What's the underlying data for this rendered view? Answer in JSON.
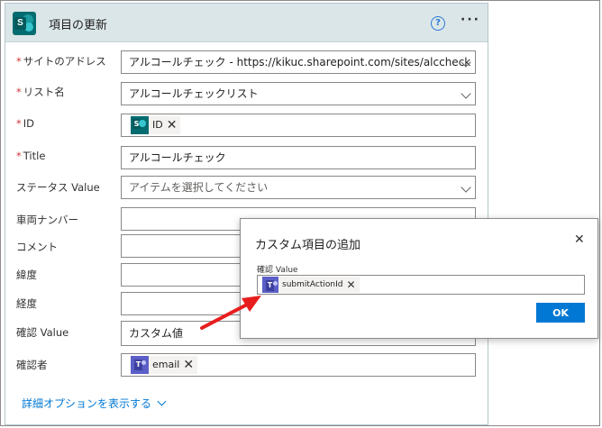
{
  "card": {
    "title": "項目の更新",
    "help_glyph": "?",
    "more_glyph": "···"
  },
  "fields": [
    {
      "label": "サイトのアドレス",
      "required": true,
      "value": "アルコールチェック - https://kikuc.sharepoint.com/sites/alccheck",
      "dropdown": true
    },
    {
      "label": "リスト名",
      "required": true,
      "value": "アルコールチェックリスト",
      "dropdown": true
    },
    {
      "label": "ID",
      "required": true,
      "token": "ID",
      "token_icon": "sharepoint-icon"
    },
    {
      "label": "Title",
      "required": true,
      "value": "アルコールチェック"
    },
    {
      "label": "ステータス Value",
      "required": false,
      "placeholder": "アイテムを選択してください",
      "dropdown": true
    },
    {
      "label": "車両ナンバー",
      "required": false,
      "value": ""
    },
    {
      "label": "コメント",
      "required": false,
      "value": ""
    },
    {
      "label": "緯度",
      "required": false,
      "value": ""
    },
    {
      "label": "経度",
      "required": false,
      "value": ""
    },
    {
      "label": "確認 Value",
      "required": false,
      "value": "カスタム値"
    },
    {
      "label": "確認者",
      "required": false,
      "token": "email",
      "token_icon": "teams-icon"
    }
  ],
  "required_mark": "*",
  "advanced_options": "詳細オプションを表示する",
  "dialog": {
    "title": "カスタム項目の追加",
    "close_glyph": "✕",
    "field_label": "確認 Value",
    "token": "submitActionId",
    "ok_label": "OK"
  },
  "colors": {
    "header_bg": "#dbe6e9",
    "accent": "#0078d4",
    "required": "#d13438",
    "arrow": "#e81e1e",
    "sharepoint": "#036c70",
    "teams": "#5b5fc7"
  }
}
